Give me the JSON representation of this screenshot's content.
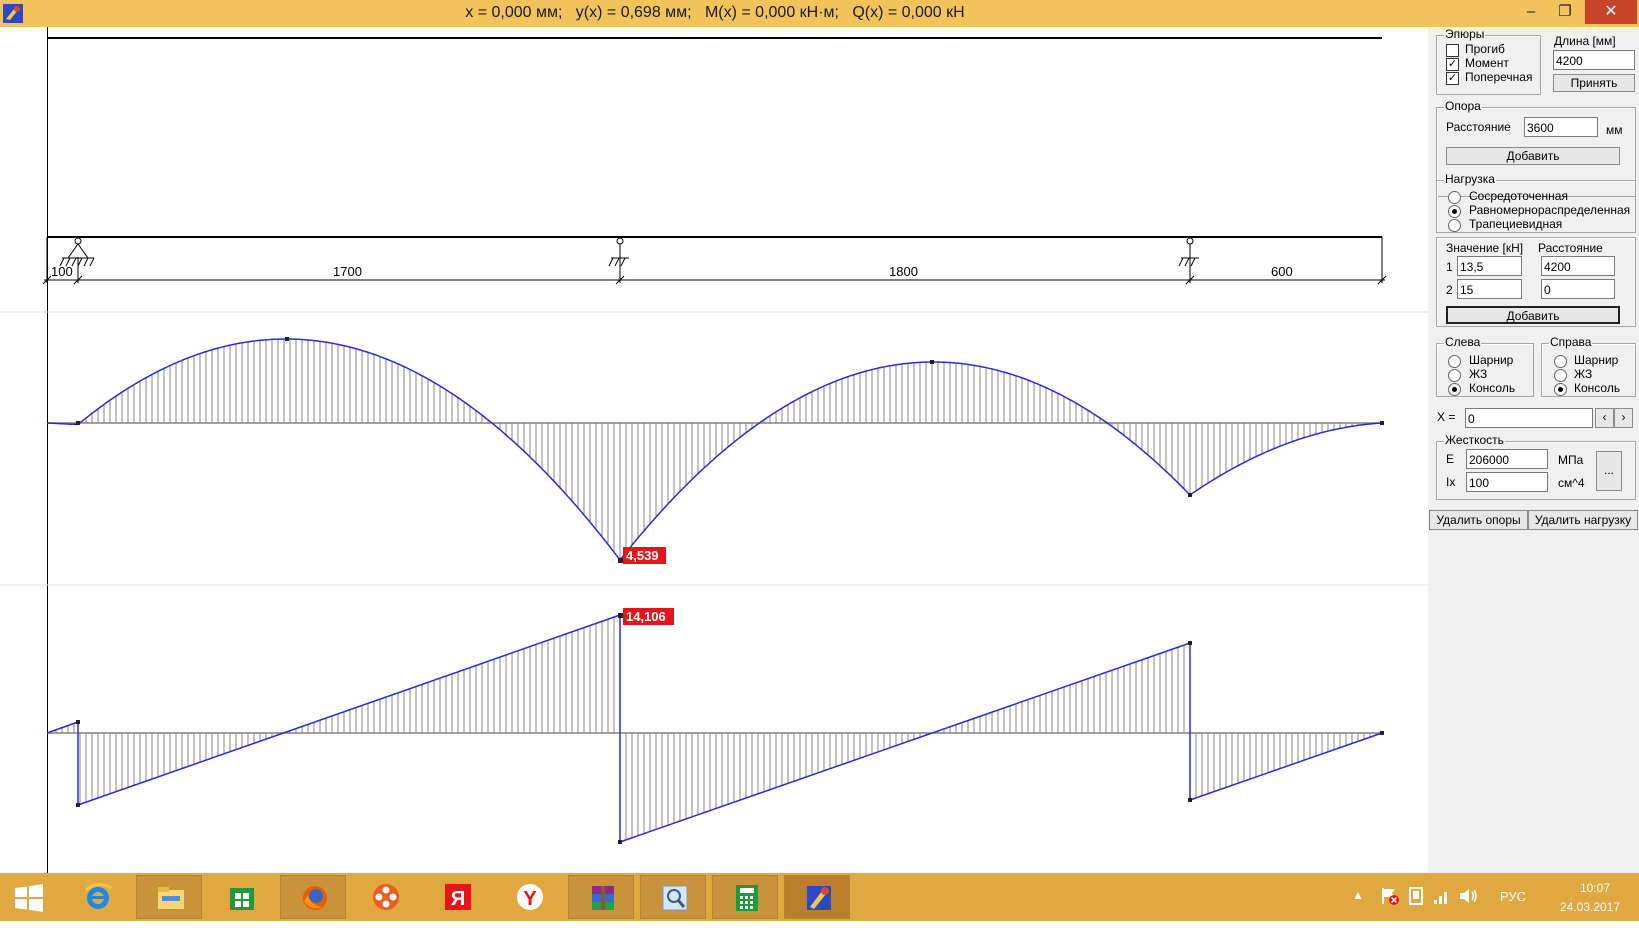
{
  "window": {
    "title": "x = 0,000 мм;   y(x) = 0,698 мм;   M(x) = 0,000 кН·м;   Q(x) = 0,000 кН",
    "min_glyph": "–",
    "max_glyph": "❐",
    "close_glyph": "✕"
  },
  "beam": {
    "span_labels": [
      "100",
      "1700",
      "1800",
      "600"
    ]
  },
  "diagrams": {
    "moment_max_label": "4,539",
    "shear_max_label": "14,106"
  },
  "panel": {
    "diagrams_group": {
      "title": "Эпюры",
      "items": [
        {
          "label": "Прогиб",
          "checked": false
        },
        {
          "label": "Момент",
          "checked": true
        },
        {
          "label": "Поперечная",
          "checked": true
        }
      ]
    },
    "length": {
      "label": "Длина [мм]",
      "value": "4200",
      "apply_button": "Принять"
    },
    "support": {
      "title": "Опора",
      "distance_label": "Расстояние",
      "distance_value": "3600",
      "unit": "мм",
      "add_button": "Добавить"
    },
    "load": {
      "title": "Нагрузка",
      "types": [
        {
          "label": "Сосредоточенная",
          "selected": false
        },
        {
          "label": "Равномернораспределенная",
          "selected": true
        },
        {
          "label": "Трапециевидная",
          "selected": false
        }
      ],
      "value_header": "Значение [кН]",
      "distance_header": "Расстояние",
      "rows": [
        {
          "index": "1",
          "value": "13,5",
          "distance": "4200"
        },
        {
          "index": "2",
          "value": "15",
          "distance": "0"
        }
      ],
      "add_button": "Добавить"
    },
    "left_end": {
      "title": "Слева",
      "options": [
        {
          "label": "Шарнир",
          "selected": false
        },
        {
          "label": "ЖЗ",
          "selected": false
        },
        {
          "label": "Консоль",
          "selected": true
        }
      ]
    },
    "right_end": {
      "title": "Справа",
      "options": [
        {
          "label": "Шарнир",
          "selected": false
        },
        {
          "label": "ЖЗ",
          "selected": false
        },
        {
          "label": "Консоль",
          "selected": true
        }
      ]
    },
    "x_field": {
      "label": "X =",
      "value": "0",
      "prev": "‹",
      "next": "›"
    },
    "stiffness": {
      "title": "Жесткость",
      "e_label": "E",
      "e_value": "206000",
      "e_unit": "МПа",
      "ix_label": "Ix",
      "ix_value": "100",
      "ix_unit": "см^4",
      "more_button": "..."
    },
    "delete_supports_button": "Удалить опоры",
    "delete_loads_button": "Удалить нагрузку"
  },
  "taskbar": {
    "apps": [
      "windows-start",
      "internet-explorer",
      "file-explorer",
      "store",
      "firefox",
      "media-player",
      "yandex-ya",
      "yandex-browser",
      "winrar",
      "magnifier",
      "calculator",
      "beam-app"
    ],
    "tray": {
      "language": "РУС",
      "time": "10:07",
      "date": "24.03.2017"
    }
  },
  "colors": {
    "titlebar": "#f3c35b",
    "taskbar": "#e0a840",
    "curve": "#2b2bd6",
    "label_bg": "#e8141c"
  }
}
